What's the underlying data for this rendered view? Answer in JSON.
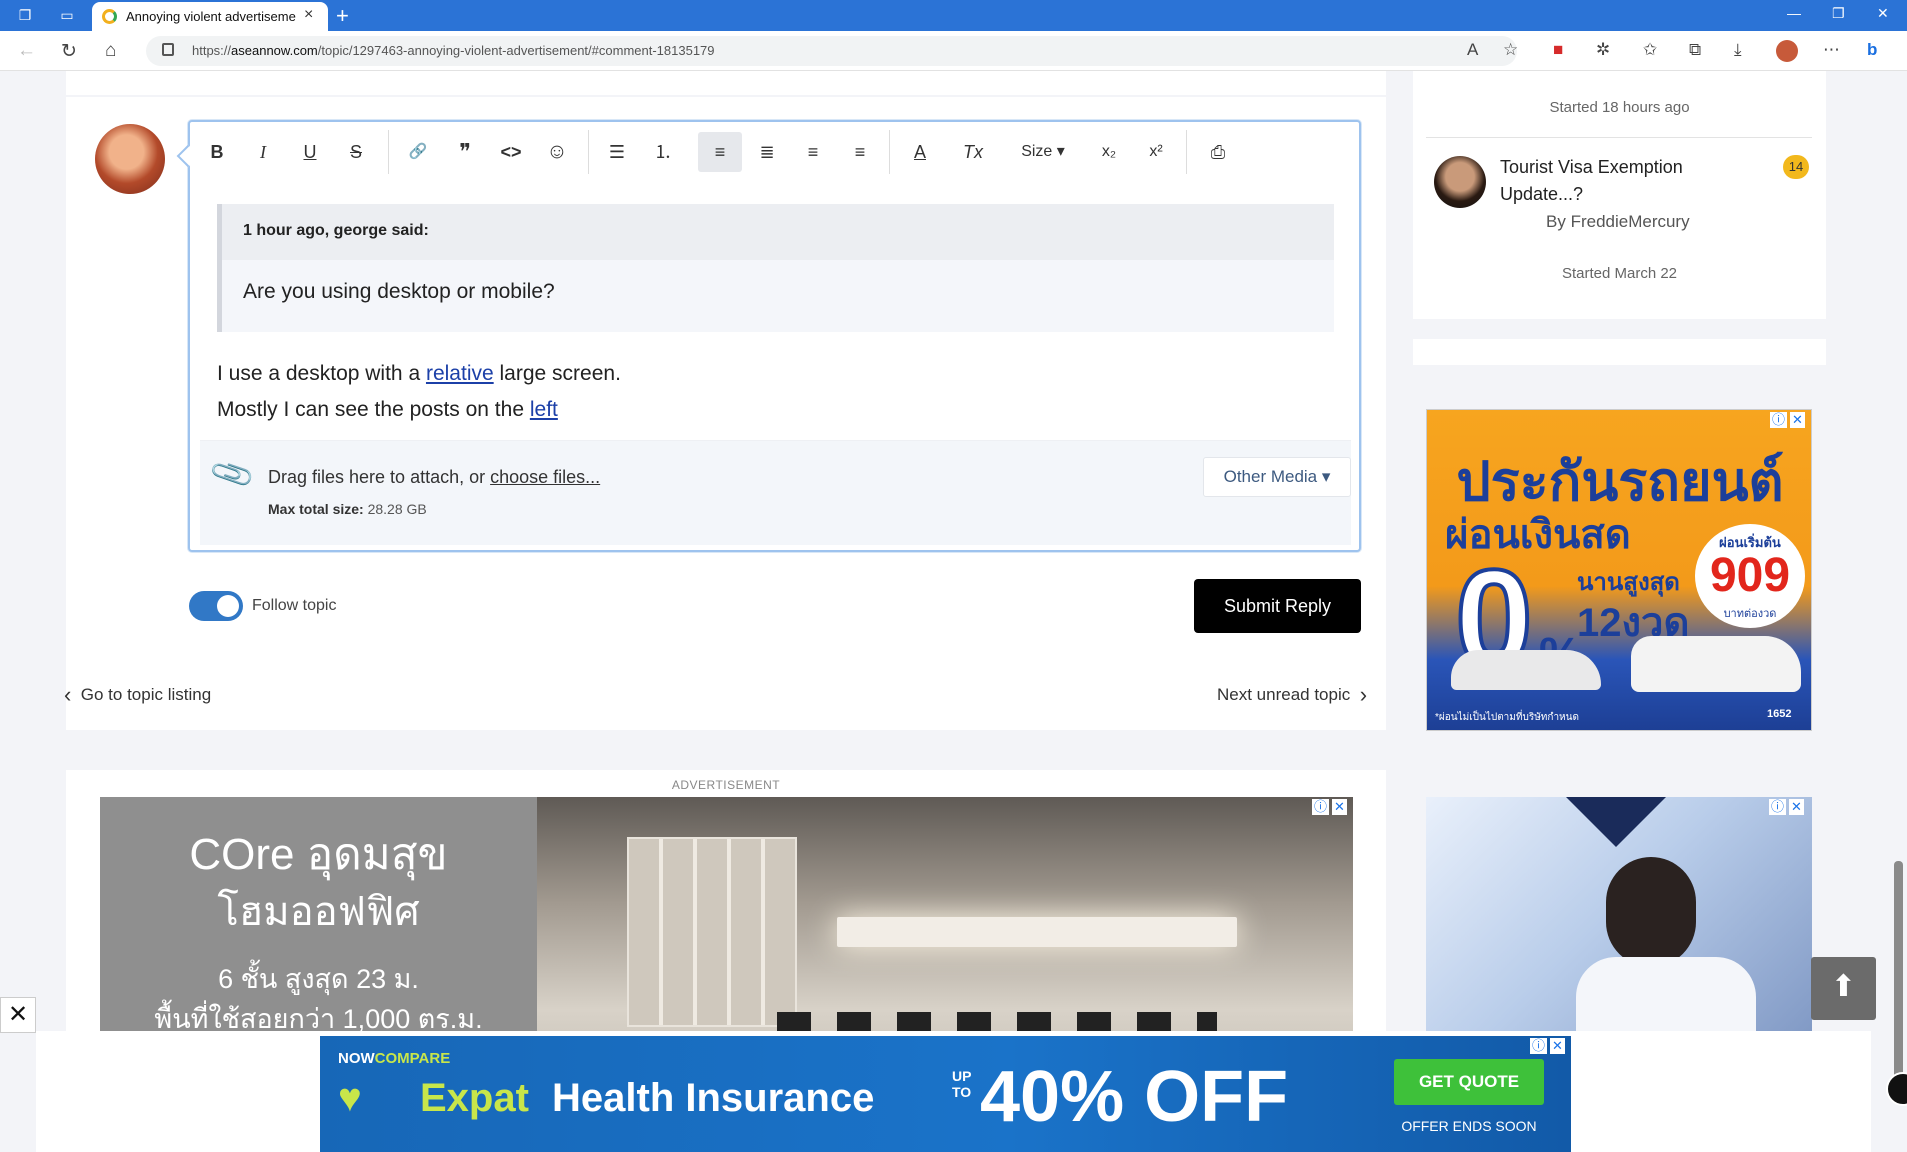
{
  "browser": {
    "tab_title": "Annoying violent advertisement",
    "url_prefix": "https://",
    "url_domain": "aseannow.com",
    "url_path": "/topic/1297463-annoying-violent-advertisement/#comment-18135179"
  },
  "editor": {
    "toolbar": {
      "bold": "B",
      "italic": "I",
      "underline": "U",
      "strike": "S",
      "link": "🔗",
      "quote": "❞",
      "code": "<>",
      "emoji": "☺",
      "bullets": "☰",
      "numbers": "⒈",
      "align_left": "≡",
      "align_justify": "≣",
      "align_center": "≡",
      "align_right": "≡",
      "text_color": "A",
      "clear_format": "Tx",
      "size": "Size",
      "subscript": "x₂",
      "superscript": "x²",
      "preview": "⎙"
    },
    "quote_author": "1 hour ago, george said:",
    "quote_text": "Are you using desktop or mobile?",
    "line1_a": "I use a desktop with a ",
    "line1_link": "relative",
    "line1_b": " large screen.",
    "line2_a": "Mostly I can see the posts on the ",
    "line2_link": "left",
    "attach_text": "Drag files here to attach, or ",
    "attach_link": "choose files...",
    "max_label": "Max total size:",
    "max_value": "28.28 GB",
    "other_media": "Other Media ▾"
  },
  "reply": {
    "follow_label": "Follow topic",
    "submit": "Submit Reply"
  },
  "pagination": {
    "prev": "Go to topic listing",
    "next": "Next unread topic"
  },
  "ads": {
    "label": "ADVERTISEMENT",
    "ad1_brand": "COre อุดมสุข",
    "ad1_line2": "โฮมออฟฟิศ",
    "ad1_line3": "6 ชั้น สูงสุด 23 ม.",
    "ad1_line4": "พื้นที่ใช้สอยกว่า 1,000 ตร.ม.",
    "ad2_title": "ประกันรถยนต์",
    "ad2_sub": "ผ่อนเงินสด",
    "ad2_zero": "0",
    "ad2_pct": "%",
    "ad2_months_a": "นานสูงสุด",
    "ad2_months_b": "12งวด",
    "ad2_start": "ผ่อนเริ่มต้น",
    "ad2_price": "909",
    "ad2_per": "บาทต่องวด",
    "ad2_note": "*ผ่อนไม่เป็นไปตามที่บริษัทกำหนด",
    "ad2_phone": "1652",
    "sticky_brand_a": "NOW",
    "sticky_brand_b": "COMPARE",
    "sticky_expat": "Expat",
    "sticky_health": "Health Insurance",
    "sticky_upto_a": "UP",
    "sticky_upto_b": "TO",
    "sticky_off": "40% OFF",
    "sticky_cta": "GET QUOTE",
    "sticky_ends": "OFFER ENDS SOON",
    "info": "ⓘ",
    "close": "✕"
  },
  "sidebar": {
    "started_1": "Started 18 hours ago",
    "topic_title": "Tourist Visa Exemption Update...?",
    "topic_count": "14",
    "by_label": "By ",
    "by_user": "FreddieMercury",
    "started_2": "Started March 22"
  },
  "colors": {
    "accent": "#3178c6",
    "tab_bar": "#2b73d6",
    "badge": "#f2b81c"
  }
}
